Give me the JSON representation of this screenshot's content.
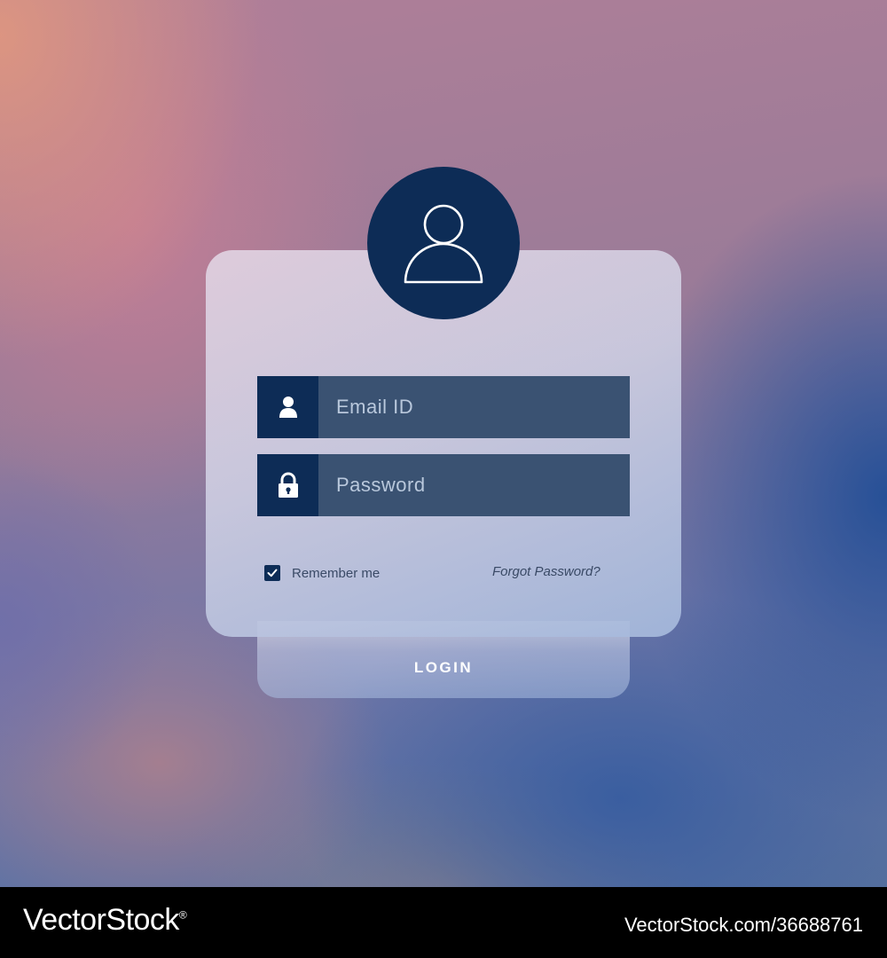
{
  "login_form": {
    "email_placeholder": "Email ID",
    "password_placeholder": "Password",
    "remember_label": "Remember me",
    "remember_checked": true,
    "forgot_link": "Forgot Password?",
    "login_button": "LOGIN"
  },
  "icons": {
    "avatar": "user-outline-icon",
    "email_field": "user-icon",
    "password_field": "lock-icon",
    "checkbox": "check-icon"
  },
  "colors": {
    "primary_navy": "#0d2c56",
    "input_fill": "#3a5272",
    "card_glass": "#d2cfe2"
  },
  "watermark": {
    "brand": "VectorStock",
    "registered_mark": "®",
    "image_ref": "VectorStock.com/36688761"
  }
}
